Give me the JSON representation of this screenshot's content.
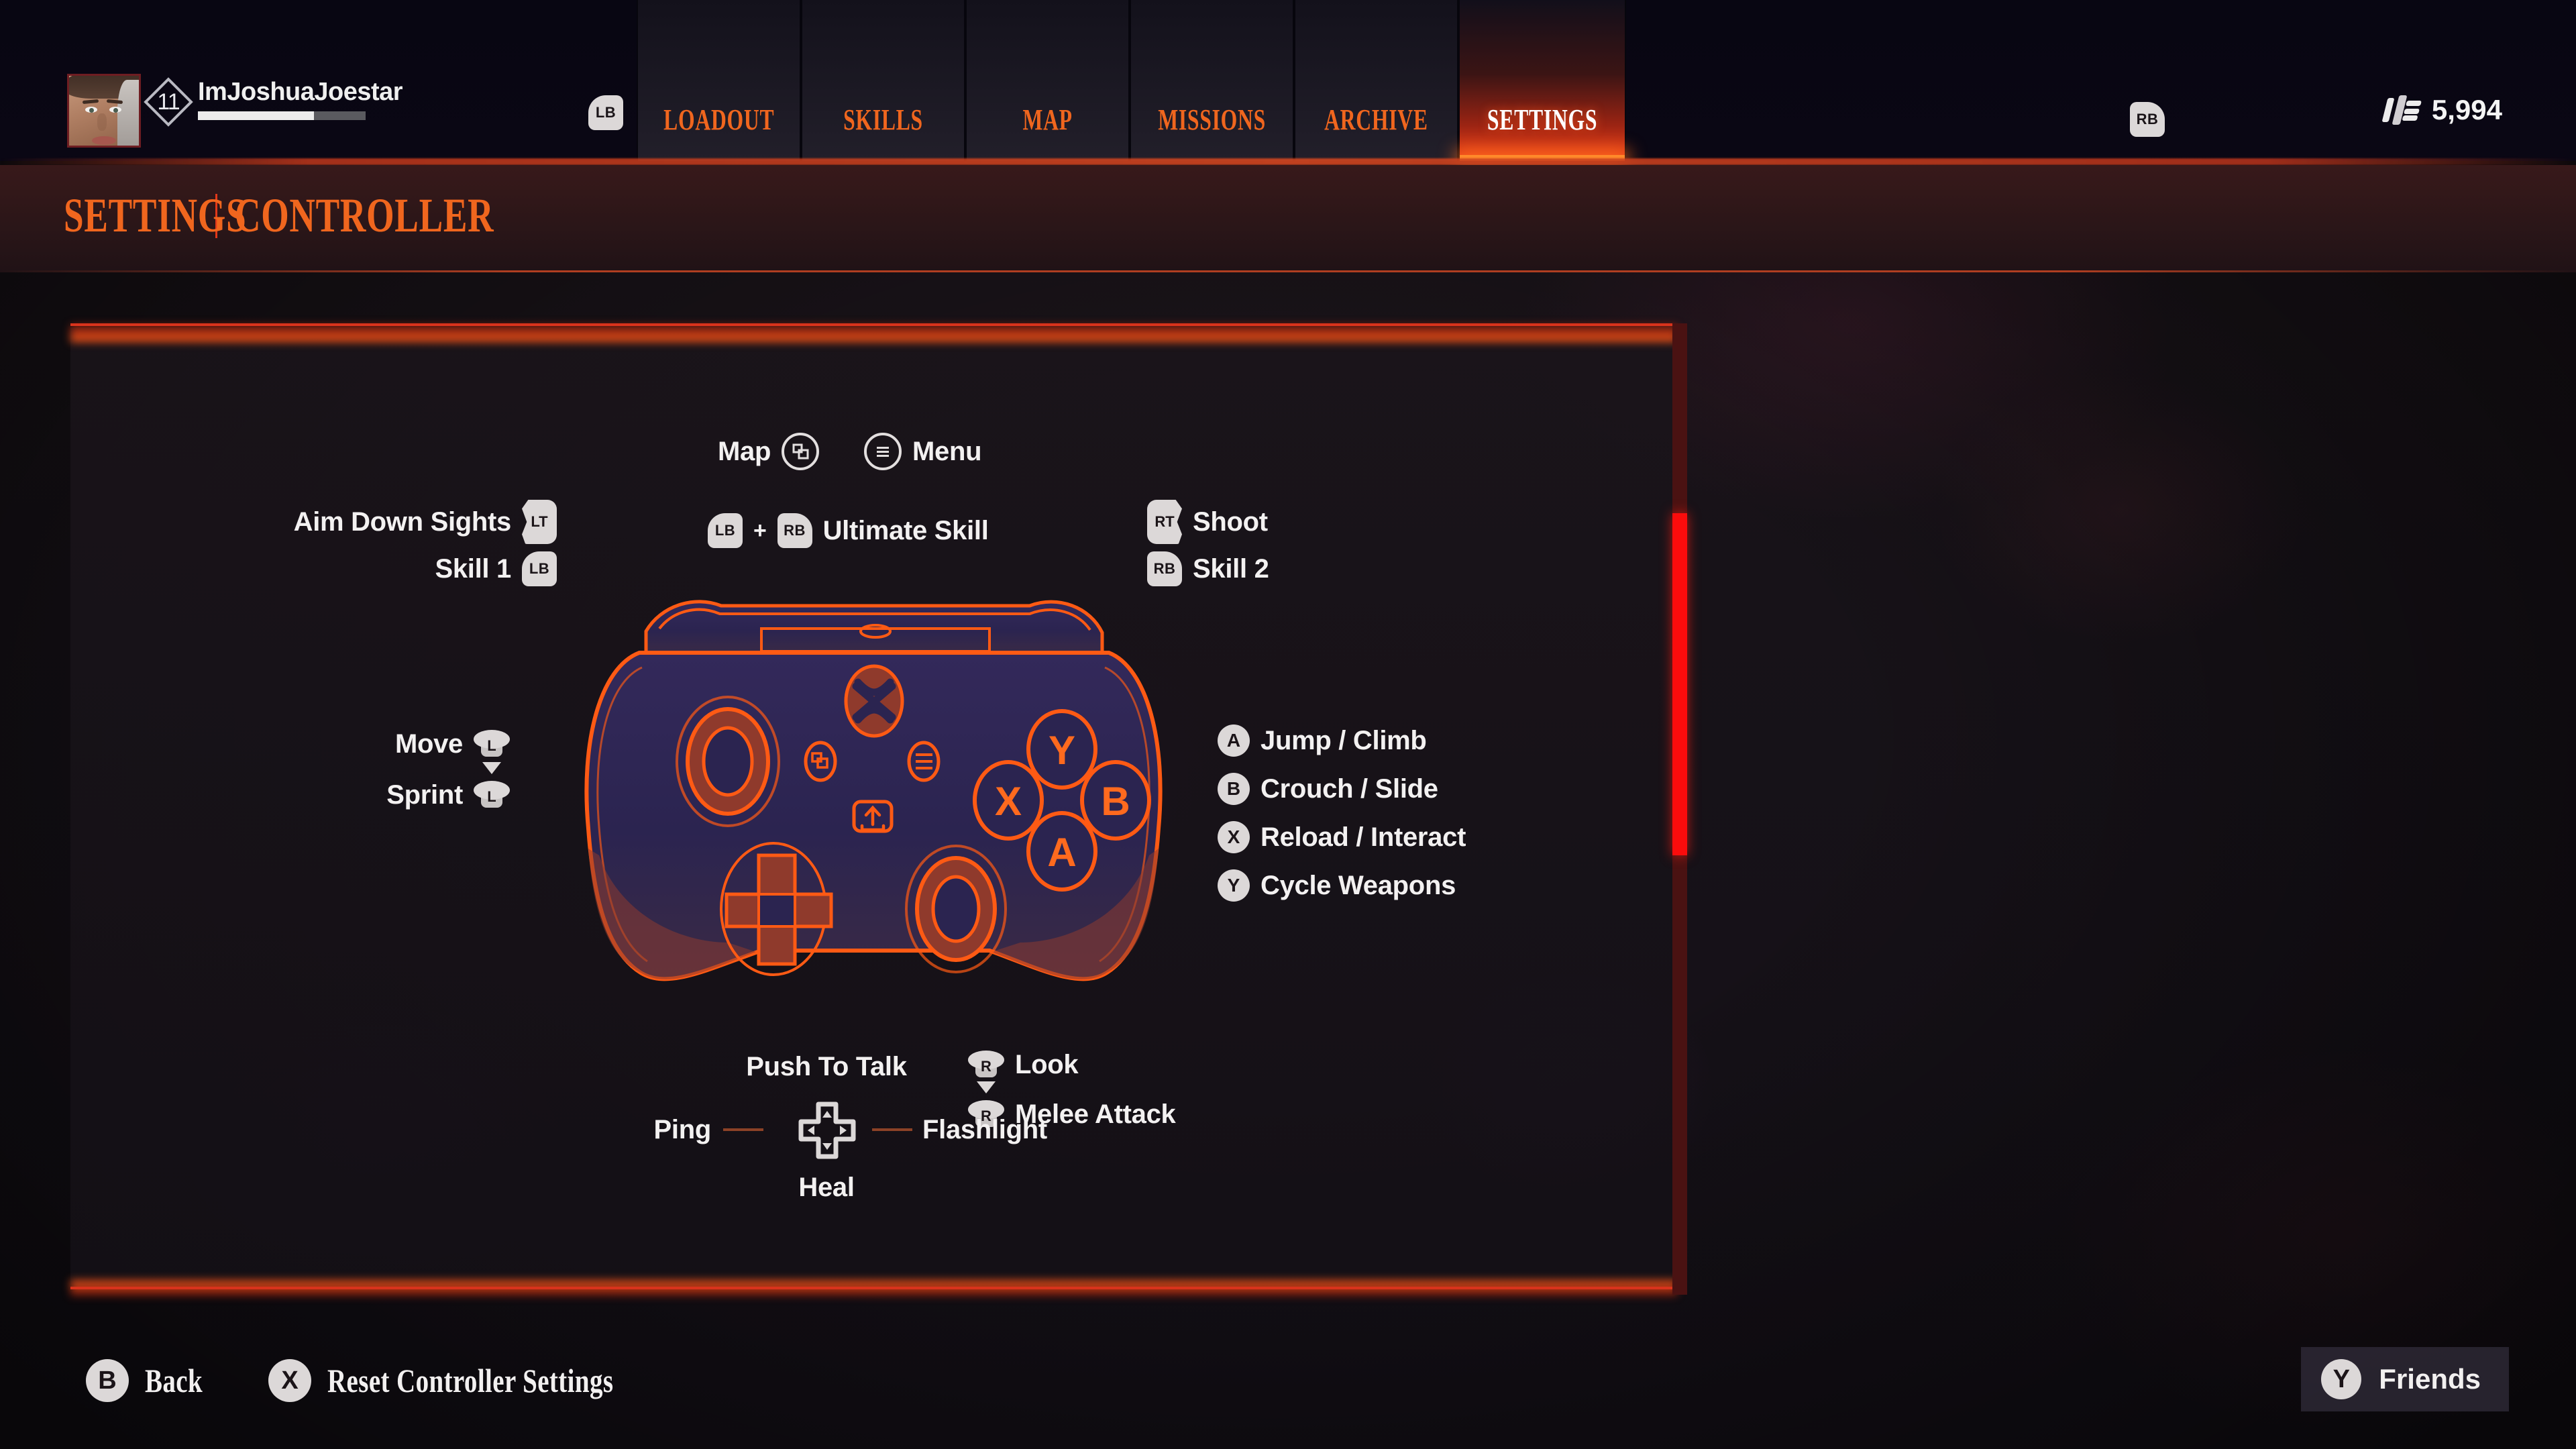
{
  "player": {
    "name": "ImJoshuaJoestar",
    "level": "11",
    "xp_percent": 69,
    "currency": "5,994",
    "lb_hint": "LB",
    "rb_hint": "RB"
  },
  "nav": {
    "tabs": [
      {
        "label": "LOADOUT",
        "active": false
      },
      {
        "label": "SKILLS",
        "active": false
      },
      {
        "label": "MAP",
        "active": false
      },
      {
        "label": "MISSIONS",
        "active": false
      },
      {
        "label": "ARCHIVE",
        "active": false
      },
      {
        "label": "SETTINGS",
        "active": true
      }
    ]
  },
  "breadcrumb": {
    "section": "SETTINGS",
    "page": "CONTROLLER"
  },
  "controller": {
    "top_center": [
      {
        "label": "Map",
        "button": "view-icon",
        "side": "left"
      },
      {
        "label": "Menu",
        "button": "menu-icon",
        "side": "right"
      }
    ],
    "left_bindings": [
      {
        "label": "Aim Down Sights",
        "button": "LT",
        "type": "trigger"
      },
      {
        "label": "Skill 1",
        "button": "LB",
        "type": "bumper"
      }
    ],
    "center_binding": {
      "button_a": "LB",
      "plus": "+",
      "button_b": "RB",
      "label": "Ultimate Skill"
    },
    "right_bindings": [
      {
        "label": "Shoot",
        "button": "RT",
        "type": "trigger"
      },
      {
        "label": "Skill 2",
        "button": "RB",
        "type": "bumper"
      }
    ],
    "left_stick_bindings": [
      {
        "label": "Move",
        "button": "L",
        "press": false
      },
      {
        "label": "Sprint",
        "button": "L",
        "press": true
      }
    ],
    "face_bindings": [
      {
        "button": "A",
        "label": "Jump / Climb"
      },
      {
        "button": "B",
        "label": "Crouch / Slide"
      },
      {
        "button": "X",
        "label": "Reload / Interact"
      },
      {
        "button": "Y",
        "label": "Cycle Weapons"
      }
    ],
    "right_stick_bindings": [
      {
        "label": "Look",
        "button": "R",
        "press": false
      },
      {
        "label": "Melee Attack",
        "button": "R",
        "press": true
      }
    ],
    "dpad_bindings": {
      "up": "Push To Talk",
      "left": "Ping",
      "right": "Flashlight",
      "down": "Heal"
    }
  },
  "footer": {
    "hints": [
      {
        "button": "B",
        "label": "Back"
      },
      {
        "button": "X",
        "label": "Reset Controller Settings"
      }
    ],
    "friends": {
      "button": "Y",
      "label": "Friends"
    }
  },
  "colors": {
    "accent_orange": "#f0661e",
    "accent_red": "#d9331c",
    "glow_orange": "#ff6a1e",
    "button_face": "#dcd8d8",
    "text_primary": "#f3f1f1",
    "scrollbar_thumb": "#fb0c0c",
    "scrollbar_track": "#4a1212",
    "controller_fill": "#2b2547",
    "controller_stroke": "#ff5a14"
  }
}
